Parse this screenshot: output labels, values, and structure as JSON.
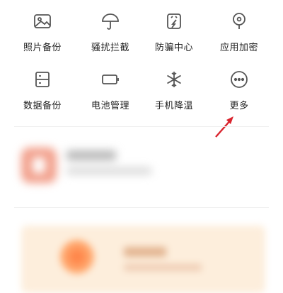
{
  "tools": [
    {
      "label": "照片备份",
      "icon": "photo-backup-icon"
    },
    {
      "label": "骚扰拦截",
      "icon": "umbrella-icon"
    },
    {
      "label": "防骗中心",
      "icon": "anti-fraud-shield-icon"
    },
    {
      "label": "应用加密",
      "icon": "app-lock-icon"
    },
    {
      "label": "数据备份",
      "icon": "data-backup-icon"
    },
    {
      "label": "电池管理",
      "icon": "battery-icon"
    },
    {
      "label": "手机降温",
      "icon": "snowflake-icon"
    },
    {
      "label": "更多",
      "icon": "more-icon"
    }
  ],
  "colors": {
    "icon_stroke": "#555555",
    "annotation_arrow": "#d9232d",
    "card_icon": "#f2a08c",
    "promo_bg": "#fdeedc"
  }
}
